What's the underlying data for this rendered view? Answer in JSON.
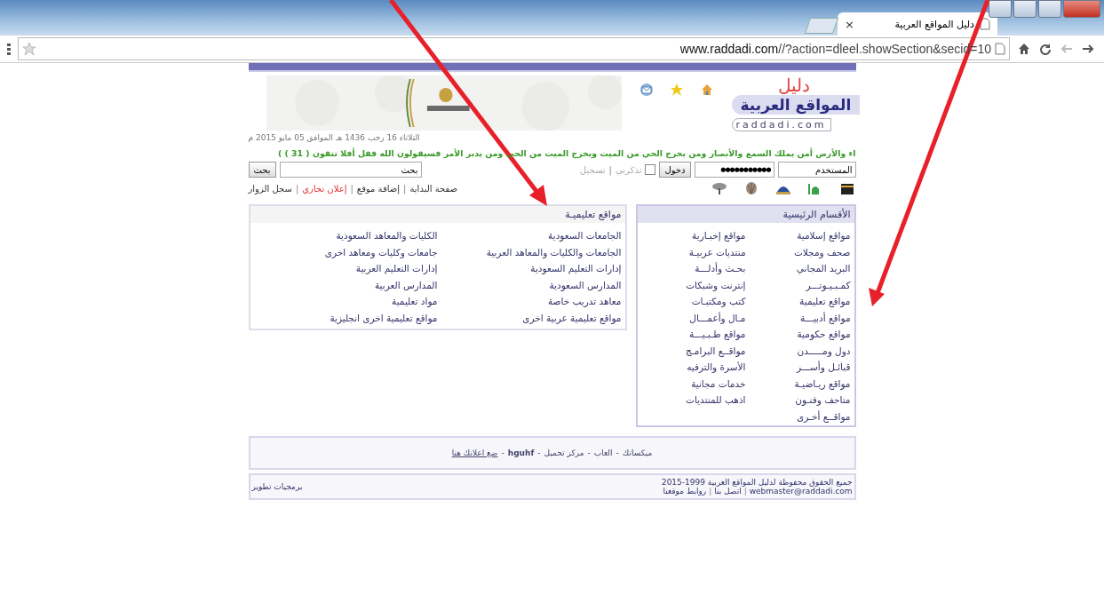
{
  "window": {
    "tab_title": "دليل المواقع العربية",
    "tab_close": "×",
    "url_host": "www.raddadi.com",
    "url_path": "//?action=dleel.showSection&secid=10"
  },
  "header": {
    "logo_script": "دليل",
    "logo_title": "المواقع العربية",
    "domain": "raddadi.com",
    "date": "التلاثاء 16 رجب 1436 هـ الموافق 05 مايو 2015 م",
    "ticker": "اء والأرض أمن يملك السمع والأبصار ومن يخرج الحي من الميت ويخرج الميت من الحي ومن يدبر الأمر فسيقولون الله فقل أفلا تتقون ( 31 ) )"
  },
  "login": {
    "username": "المستخدم",
    "password": "●●●●●●●●●●●",
    "button": "دخول",
    "remember": {
      "label": "تذكرني",
      "checked": false
    },
    "register": "تسجيل",
    "search_value": "بحث",
    "search_button": "بحث"
  },
  "nav_links": [
    {
      "label": "صفحة البداية",
      "kind": "normal"
    },
    {
      "label": "إضافة موقع",
      "kind": "normal"
    },
    {
      "label": "إعلان تجاري",
      "kind": "highlight"
    },
    {
      "label": "سجل الزوار",
      "kind": "normal"
    }
  ],
  "main_categories": {
    "title": "الأقسام الرئيسية",
    "items": [
      "مواقع إسلامية",
      "مواقع إخبـارية",
      "صحف ومجلات",
      "منتديات عربيـة",
      "البريد المجاني",
      "بحـث وأدلـــة",
      "كمـبـيـوتـــر",
      "إنترنت وشبكات",
      "مواقع تعليمية",
      "كتب ومكتبـات",
      "مواقع أدبيـــة",
      "مـال وأعمـــال",
      "مواقع حكومية",
      "مواقع طـبـيـــة",
      "دول ومـــــدن",
      "مواقــع البرامـج",
      "قبائـل وأســـر",
      "الأسرة والترفيه",
      "مواقع ريـاضيـة",
      "خدمات مجانية",
      "متاحف وفنـون",
      "اذهب للمنتديات",
      "مواقــع أخـرى"
    ]
  },
  "section": {
    "title": "مواقع تعليميـة",
    "items": [
      "الجامعات السعودية",
      "الكليات والمعاهد السعودية",
      "الجامعات والكليات والمعاهد العربية",
      "جامعات وكليات ومعاهد اخرى",
      "إدارات التعليم السعودية",
      "إدارات التعليم العربية",
      "المدارس السعودية",
      "المدارس العربية",
      "معاهد تدريب خاصة",
      "مواد تعليمية",
      "مواقع تعليمية عربية اخرى",
      "مواقع تعليمية اخرى انجليزية"
    ]
  },
  "footer_links": [
    {
      "label": "ميكساتك",
      "kind": "plain"
    },
    {
      "label": "العاب",
      "kind": "plain"
    },
    {
      "label": "مركز تحميل",
      "kind": "plain"
    },
    {
      "label": "hguhf",
      "kind": "bold"
    },
    {
      "label": "ضع اعلانك هنا",
      "kind": "underline"
    }
  ],
  "copyright": "جميع الحقوق محفوظة لدليل المواقع العربية 1999-2015",
  "contact_links": [
    "webmaster@raddadi.com",
    "اتصل بنا",
    "روابط موقعنا"
  ],
  "credit": "برمجيات تطوير",
  "link_separator": "|",
  "footer_separator": "-"
}
